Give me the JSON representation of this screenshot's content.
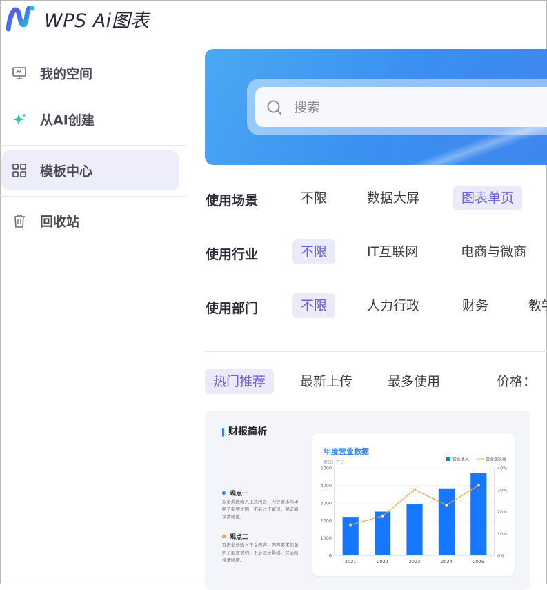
{
  "header": {
    "brand": "WPS Ai图表"
  },
  "sidebar": {
    "items": [
      {
        "label": "我的空间",
        "icon": "monitor-icon"
      },
      {
        "label": "从AI创建",
        "icon": "sparkle-icon"
      },
      {
        "label": "模板中心",
        "icon": "grid-icon",
        "active": true
      },
      {
        "label": "回收站",
        "icon": "trash-icon"
      }
    ]
  },
  "search": {
    "placeholder": "搜索"
  },
  "filters": {
    "scene": {
      "label": "使用场景",
      "options": [
        "不限",
        "数据大屏",
        "图表单页"
      ],
      "selected": "图表单页"
    },
    "industry": {
      "label": "使用行业",
      "options": [
        "不限",
        "IT互联网",
        "电商与微商"
      ],
      "selected": "不限"
    },
    "department": {
      "label": "使用部门",
      "options": [
        "不限",
        "人力行政",
        "财务",
        "教学"
      ],
      "selected": "不限"
    }
  },
  "sort": {
    "options": [
      "热门推荐",
      "最新上传",
      "最多使用"
    ],
    "selected": "热门推荐",
    "price_label": "价格："
  },
  "card": {
    "title": "财报简析",
    "viewpoints": [
      {
        "title": "观点一",
        "text": "双击此处输入正文内容，内容要求简单明了能要说明，不必过于繁琐，保证阅读清晰度。",
        "color": "#2f80ed"
      },
      {
        "title": "观点二",
        "text": "双击此处输入正文内容，内容要求简单明了能要说明，不必过于繁琐，保证阅读清晰度。",
        "color": "#f0a040"
      }
    ]
  },
  "chart_data": {
    "type": "bar",
    "title": "年度营业数据",
    "unit_label": "单位：万元",
    "categories": [
      "2021",
      "2022",
      "2023",
      "2024",
      "2025"
    ],
    "series": [
      {
        "name": "营业收入",
        "type": "bar",
        "axis": "left",
        "color": "#1677ff",
        "values": [
          2200,
          2500,
          2950,
          3830,
          4700
        ]
      },
      {
        "name": "营业涨跌幅",
        "type": "line",
        "axis": "right",
        "color": "#f0a040",
        "values": [
          14,
          18,
          30,
          23,
          32
        ]
      }
    ],
    "ylim_left": [
      0,
      5000
    ],
    "yticks_left": [
      "0",
      "1000",
      "2000",
      "3000",
      "4000",
      "5000"
    ],
    "ylim_right": [
      0,
      40
    ],
    "yticks_right": [
      "0%",
      "10%",
      "20%",
      "30%",
      "40%"
    ],
    "legend_position": "top-right",
    "grid": true
  }
}
